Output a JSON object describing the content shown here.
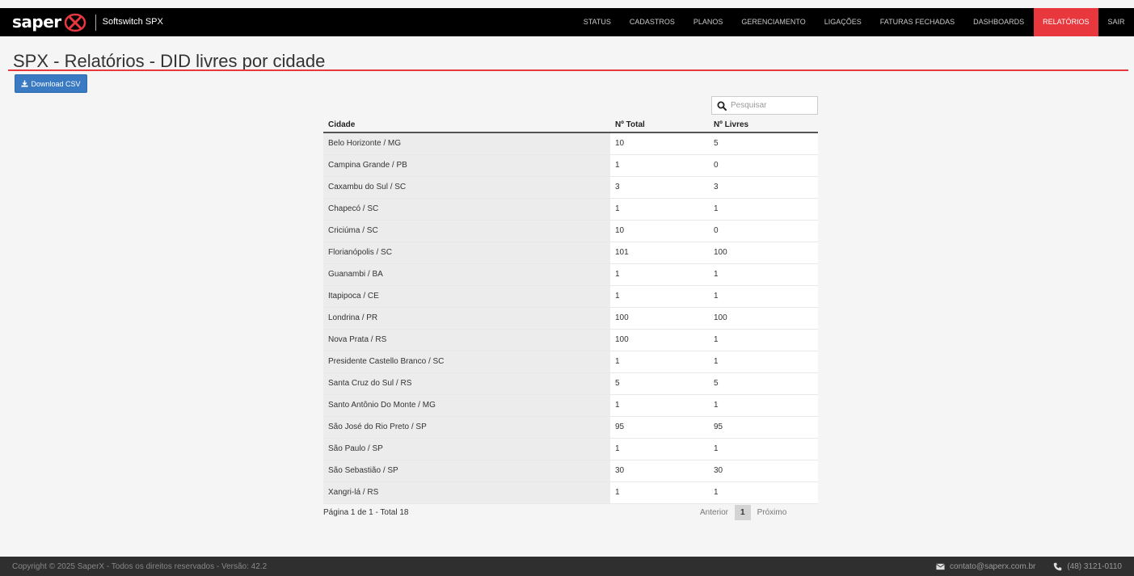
{
  "brand": {
    "logo_text": "saper",
    "subtitle": "Softswitch SPX"
  },
  "nav": [
    {
      "label": "STATUS",
      "active": false
    },
    {
      "label": "CADASTROS",
      "active": false
    },
    {
      "label": "PLANOS",
      "active": false
    },
    {
      "label": "GERENCIAMENTO",
      "active": false
    },
    {
      "label": "LIGAÇÕES",
      "active": false
    },
    {
      "label": "FATURAS FECHADAS",
      "active": false
    },
    {
      "label": "DASHBOARDS",
      "active": false
    },
    {
      "label": "RELATÓRIOS",
      "active": true
    },
    {
      "label": "SAIR",
      "active": false
    }
  ],
  "page": {
    "title": "SPX - Relatórios - DID livres por cidade",
    "download_label": "Download CSV"
  },
  "search": {
    "placeholder": "Pesquisar"
  },
  "table": {
    "headers": [
      "Cidade",
      "Nº Total",
      "Nº Livres"
    ],
    "rows": [
      [
        "Belo Horizonte / MG",
        "10",
        "5"
      ],
      [
        "Campina Grande / PB",
        "1",
        "0"
      ],
      [
        "Caxambu do Sul / SC",
        "3",
        "3"
      ],
      [
        "Chapecó / SC",
        "1",
        "1"
      ],
      [
        "Criciúma / SC",
        "10",
        "0"
      ],
      [
        "Florianópolis / SC",
        "101",
        "100"
      ],
      [
        "Guanambi / BA",
        "1",
        "1"
      ],
      [
        "Itapipoca / CE",
        "1",
        "1"
      ],
      [
        "Londrina / PR",
        "100",
        "100"
      ],
      [
        "Nova Prata / RS",
        "100",
        "1"
      ],
      [
        "Presidente Castello Branco / SC",
        "1",
        "1"
      ],
      [
        "Santa Cruz do Sul / RS",
        "5",
        "5"
      ],
      [
        "Santo Antônio Do Monte / MG",
        "1",
        "1"
      ],
      [
        "São José do Rio Preto / SP",
        "95",
        "95"
      ],
      [
        "São Paulo / SP",
        "1",
        "1"
      ],
      [
        "São Sebastião / SP",
        "30",
        "30"
      ],
      [
        "Xangri-lá / RS",
        "1",
        "1"
      ]
    ]
  },
  "pagination": {
    "info": "Página 1 de 1 - Total 18",
    "prev": "Anterior",
    "current": "1",
    "next": "Próximo"
  },
  "footer": {
    "copyright": "Copyright © 2025 SaperX - Todos os direitos reservados - Versão: 42.2",
    "email": "contato@saperx.com.br",
    "phone": "(48) 3121-0110"
  },
  "icons": {
    "download": "download-icon",
    "search": "search-icon",
    "mail": "envelope-icon",
    "phone": "phone-icon",
    "logo": "x-circle-logo"
  },
  "colors": {
    "accent": "#e8383d",
    "primary_button": "#3a7ac3",
    "navbar": "#000000",
    "footer": "#2f2f2f"
  }
}
